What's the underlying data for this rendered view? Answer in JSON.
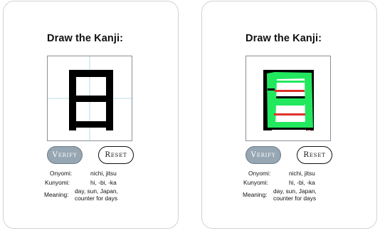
{
  "cards": [
    {
      "heading": "Draw the Kanji:",
      "verify_label": "Verify",
      "reset_label": "Reset",
      "onyomi_label": "Onyomi:",
      "onyomi_value": "nichi, jitsu",
      "kunyomi_label": "Kunyomi:",
      "kunyomi_value": "hi, -bi, -ka",
      "meaning_label": "Meaning:",
      "meaning_line1": "day, sun, Japan,",
      "meaning_line2": "counter for days"
    },
    {
      "heading": "Draw the Kanji:",
      "verify_label": "Verify",
      "reset_label": "Reset",
      "onyomi_label": "Onyomi:",
      "onyomi_value": "nichi, jitsu",
      "kunyomi_label": "Kunyomi:",
      "kunyomi_value": "hi, -bi, -ka",
      "meaning_label": "Meaning:",
      "meaning_line1": "day, sun, Japan,",
      "meaning_line2": "counter for days"
    }
  ],
  "colors": {
    "stroke_black": "#000000",
    "overlay_green": "#22e85e",
    "overlay_red": "#e0312b",
    "guide_line": "#9fd3e3",
    "verify_bg": "#96a6b3"
  }
}
